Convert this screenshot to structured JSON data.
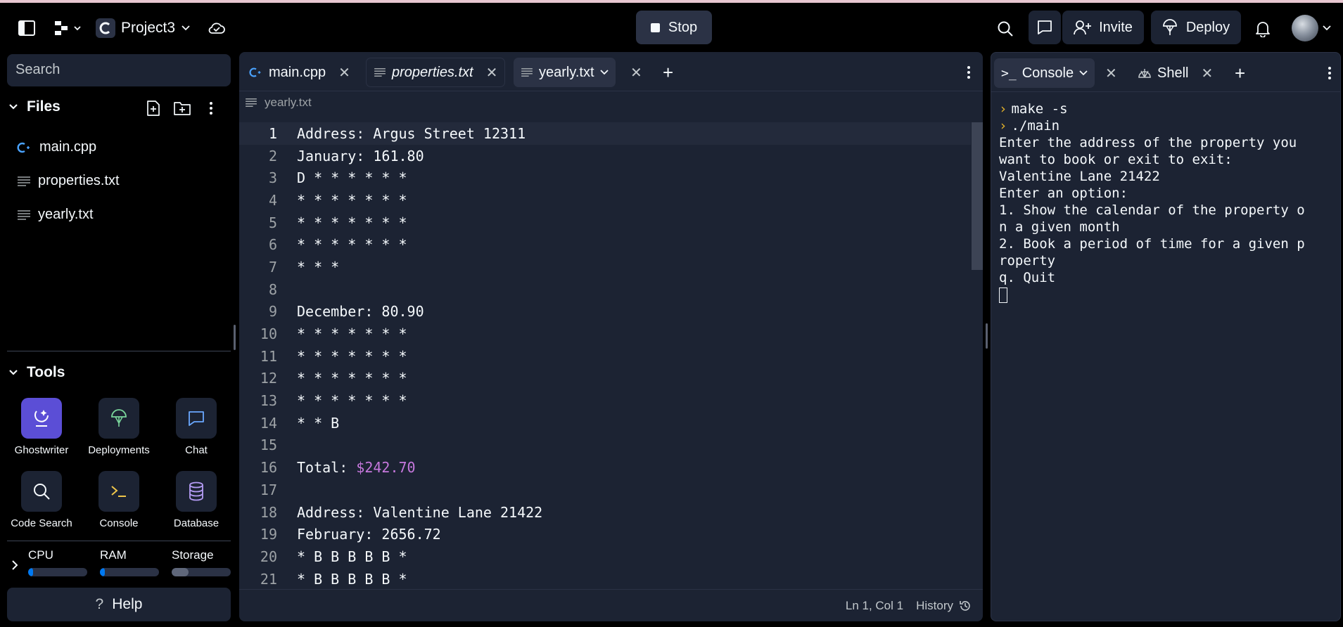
{
  "header": {
    "project_name": "Project3",
    "stop_label": "Stop",
    "invite_label": "Invite",
    "deploy_label": "Deploy"
  },
  "sidebar": {
    "search_placeholder": "Search",
    "files_heading": "Files",
    "files": [
      "main.cpp",
      "properties.txt",
      "yearly.txt"
    ],
    "tools_heading": "Tools",
    "tools": [
      "Ghostwriter",
      "Deployments",
      "Chat",
      "Code Search",
      "Console",
      "Database"
    ],
    "resources": [
      {
        "label": "CPU",
        "fill": 0.08,
        "color": "#0079f2"
      },
      {
        "label": "RAM",
        "fill": 0.08,
        "color": "#0079f2"
      },
      {
        "label": "Storage",
        "fill": 0.28,
        "color": "#5f677a"
      }
    ],
    "help_label": "Help"
  },
  "editor": {
    "tabs": [
      "main.cpp",
      "properties.txt",
      "yearly.txt"
    ],
    "breadcrumb": "yearly.txt",
    "lines": [
      "Address: Argus Street 12311",
      "January: 161.80",
      "D * * * * * *",
      "* * * * * * *",
      "* * * * * * *",
      "* * * * * * *",
      "* * *",
      "",
      "December: 80.90",
      "* * * * * * *",
      "* * * * * * *",
      "* * * * * * *",
      "* * * * * * *",
      "* * B",
      "",
      "Total: ",
      "",
      "Address: Valentine Lane 21422",
      "February: 2656.72",
      "* B B B B B *",
      "* B B B B B *"
    ],
    "total_amount": "$242.70",
    "cursor_position": "Ln 1, Col 1",
    "history_label": "History"
  },
  "console": {
    "tabs": [
      "Console",
      "Shell"
    ],
    "commands": [
      "make -s",
      "./main"
    ],
    "output": [
      "Enter the address of the property you",
      "want to book or exit to exit:",
      "Valentine Lane 21422",
      "Enter an option:",
      "1. Show the calendar of the property o",
      "n a given month",
      "2. Book a period of time for a given p",
      "roperty",
      "q. Quit"
    ]
  }
}
